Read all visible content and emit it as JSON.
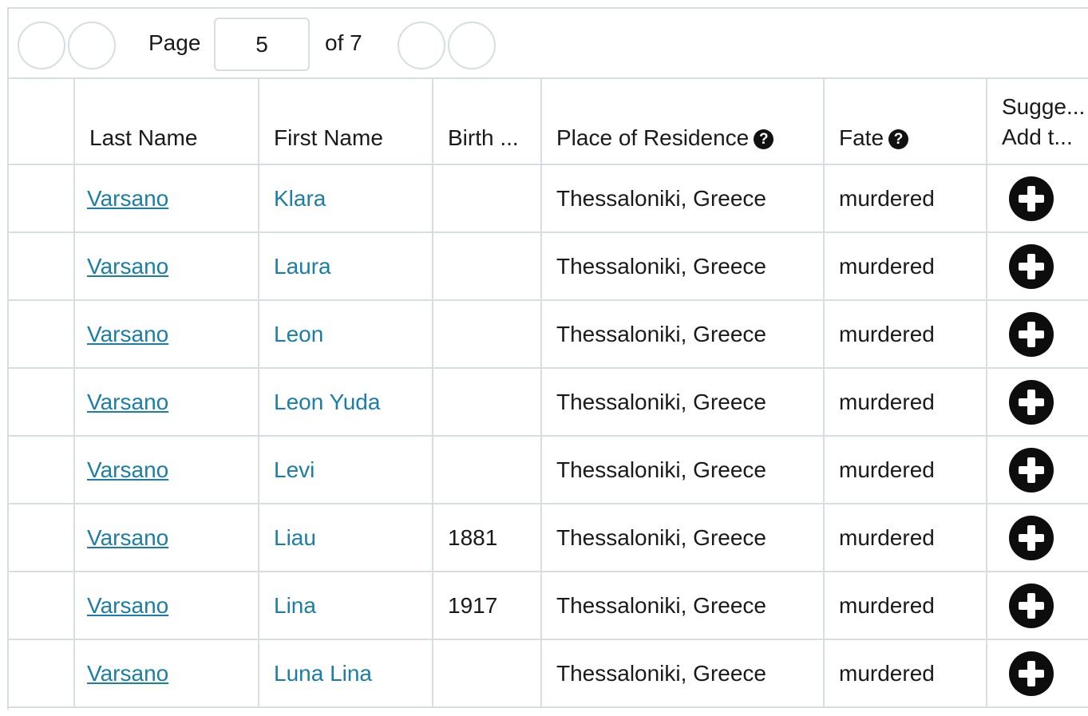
{
  "pager": {
    "page_label": "Page",
    "current_page": "5",
    "of_label": "of 7"
  },
  "table": {
    "headers": {
      "last_name": "Last Name",
      "first_name": "First Name",
      "birth": "Birth ...",
      "residence": "Place of Residence",
      "fate": "Fate",
      "suggest_line1": "Sugge...",
      "suggest_line2": "Add t..."
    },
    "rows": [
      {
        "last": "Varsano",
        "first": "Klara",
        "birth": "",
        "residence": "Thessaloniki, Greece",
        "fate": "murdered"
      },
      {
        "last": "Varsano",
        "first": "Laura",
        "birth": "",
        "residence": "Thessaloniki, Greece",
        "fate": "murdered"
      },
      {
        "last": "Varsano",
        "first": "Leon",
        "birth": "",
        "residence": "Thessaloniki, Greece",
        "fate": "murdered"
      },
      {
        "last": "Varsano",
        "first": "Leon Yuda",
        "birth": "",
        "residence": "Thessaloniki, Greece",
        "fate": "murdered"
      },
      {
        "last": "Varsano",
        "first": "Levi",
        "birth": "",
        "residence": "Thessaloniki, Greece",
        "fate": "murdered"
      },
      {
        "last": "Varsano",
        "first": "Liau",
        "birth": "1881",
        "residence": "Thessaloniki, Greece",
        "fate": "murdered"
      },
      {
        "last": "Varsano",
        "first": "Lina",
        "birth": "1917",
        "residence": "Thessaloniki, Greece",
        "fate": "murdered"
      },
      {
        "last": "Varsano",
        "first": "Luna Lina",
        "birth": "",
        "residence": "Thessaloniki, Greece",
        "fate": "murdered"
      }
    ]
  },
  "icons": {
    "pager_buttons": [
      "first-page-icon",
      "prev-page-icon",
      "next-page-icon",
      "last-page-icon"
    ],
    "help": "question-circle-icon",
    "add": "plus-circle-icon"
  },
  "colors": {
    "link": "#1b7ea6",
    "border": "#d6dee1",
    "icon": "#0d0d0d"
  }
}
